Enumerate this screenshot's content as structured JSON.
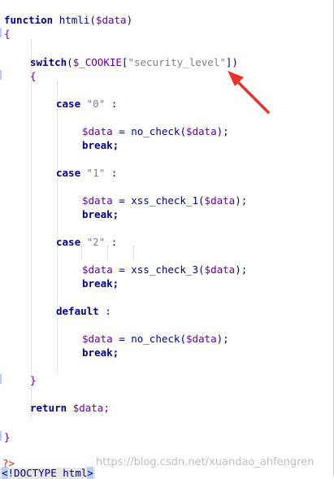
{
  "code": {
    "fn_keyword": "function",
    "fn_name": "htmli",
    "fn_param": "$data",
    "open_brace_1": "{",
    "switch_keyword": "switch",
    "cookie_var": "$_COOKIE",
    "cookie_key": "\"security_level\"",
    "open_brace_2": "{",
    "cases": [
      {
        "keyword": "case",
        "value": "\"0\"",
        "colon": ":",
        "assign_var": "$data",
        "func": "no_check",
        "arg": "$data",
        "brk": "break;"
      },
      {
        "keyword": "case",
        "value": "\"1\"",
        "colon": ":",
        "assign_var": "$data",
        "func": "xss_check_1",
        "arg": "$data",
        "brk": "break;"
      },
      {
        "keyword": "case",
        "value": "\"2\"",
        "colon": ":",
        "assign_var": "$data",
        "func": "xss_check_3",
        "arg": "$data",
        "brk": "break;"
      }
    ],
    "default_case": {
      "keyword": "default",
      "colon": ":",
      "assign_var": "$data",
      "func": "no_check",
      "arg": "$data",
      "brk": "break;"
    },
    "close_brace_2": "}",
    "return_keyword": "return",
    "return_var": "$data;",
    "close_brace_1": "}",
    "php_close": "?>",
    "doctype_lt": "<",
    "doctype_text": "!DOCTYPE html",
    "doctype_gt": ">"
  },
  "watermark": "https://blog.csdn.net/xuandao_ahfengren",
  "colors": {
    "keyword": "#000080",
    "variable": "#660099",
    "string": "#808080",
    "annotation_arrow": "#e8332a"
  }
}
